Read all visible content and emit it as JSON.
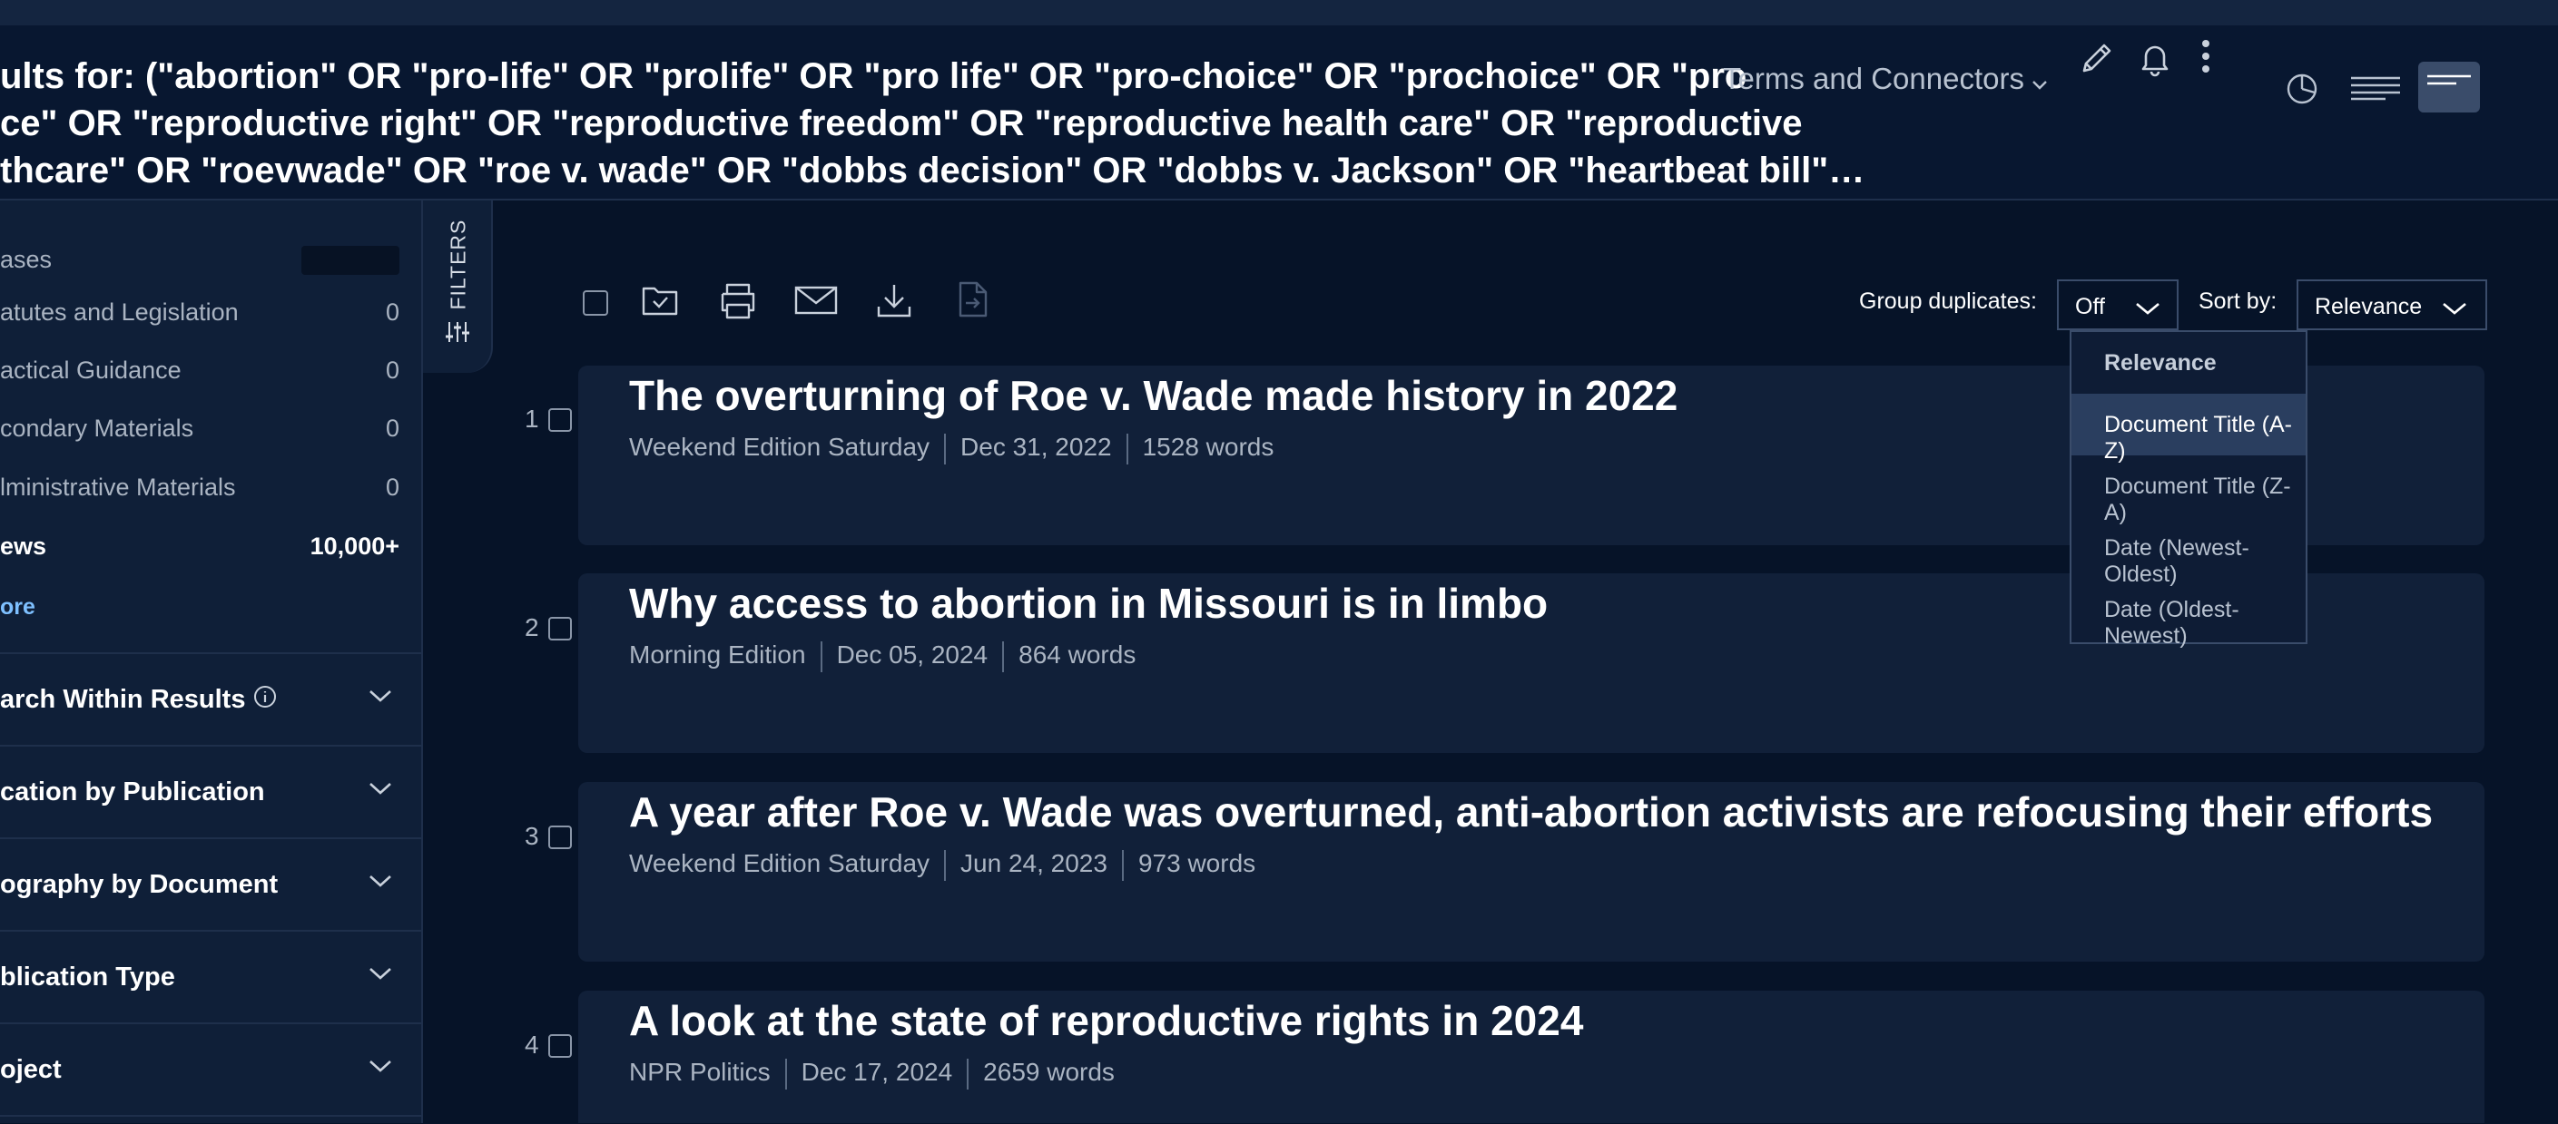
{
  "header": {
    "query_lines": [
      "ults for: (\"abortion\" OR \"pro-life\" OR \"prolife\" OR \"pro life\" OR \"pro-choice\" OR \"prochoice\" OR \"pro",
      "ce\" OR \"reproductive right\" OR \"reproductive freedom\" OR \"reproductive health care\" OR \"reproductive",
      "thcare\" OR \"roevwade\" OR \"roe v. wade\" OR \"dobbs decision\" OR \"dobbs v. Jackson\" OR \"heartbeat bill\"…"
    ],
    "terms_label": "Terms and Connectors",
    "icons": [
      "pencil-icon",
      "bell-icon",
      "more-vertical-icon",
      "pie-chart-icon",
      "list-view-icon",
      "summary-view-icon"
    ]
  },
  "sidebar": {
    "content_types": [
      {
        "label": "ases",
        "count": ""
      },
      {
        "label": "atutes and Legislation",
        "count": "0"
      },
      {
        "label": "actical Guidance",
        "count": "0"
      },
      {
        "label": "condary Materials",
        "count": "0"
      },
      {
        "label": "lministrative Materials",
        "count": "0"
      },
      {
        "label": "ews",
        "count": "10,000+"
      }
    ],
    "more_label": "ore",
    "sections": [
      {
        "label": "arch Within Results"
      },
      {
        "label": "cation by Publication"
      },
      {
        "label": "ography by Document"
      },
      {
        "label": "blication Type"
      },
      {
        "label": "oject"
      }
    ]
  },
  "filters_tab": {
    "label": "FILTERS"
  },
  "toolbar": {
    "group_duplicates_label": "Group duplicates:",
    "group_duplicates_value": "Off",
    "sort_by_label": "Sort by:",
    "sort_by_value": "Relevance",
    "sort_options": [
      "Relevance",
      "Document Title (A-Z)",
      "Document Title (Z-A)",
      "Date (Newest-Oldest)",
      "Date (Oldest-Newest)"
    ],
    "highlighted_option": "Document Title (A-Z)"
  },
  "results": [
    {
      "num": "1",
      "title": "The overturning of Roe v. Wade made history in 2022",
      "source": "Weekend Edition Saturday",
      "date": "Dec 31, 2022",
      "words": "1528 words"
    },
    {
      "num": "2",
      "title": "Why access to abortion in Missouri is in limbo",
      "source": "Morning Edition",
      "date": "Dec 05, 2024",
      "words": "864 words"
    },
    {
      "num": "3",
      "title": "A year after Roe v. Wade was overturned, anti-abortion activists are refocusing their efforts",
      "source": "Weekend Edition Saturday",
      "date": "Jun 24, 2023",
      "words": "973 words"
    },
    {
      "num": "4",
      "title": "A look at the state of reproductive rights in 2024",
      "source": "NPR Politics",
      "date": "Dec 17, 2024",
      "words": "2659 words"
    }
  ]
}
